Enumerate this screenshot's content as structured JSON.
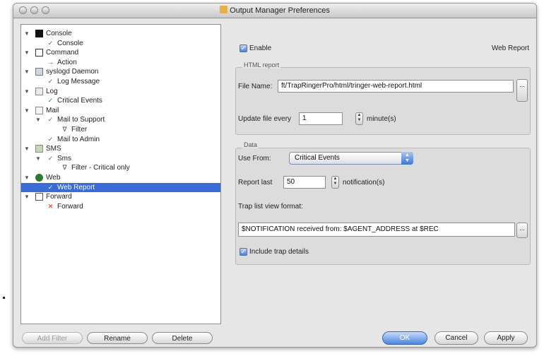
{
  "window": {
    "title": "Output Manager Preferences"
  },
  "tree": {
    "items": [
      {
        "label": "Console",
        "level": 0,
        "icon": "console-icon"
      },
      {
        "label": "Console",
        "level": 1,
        "icon": "check-icon"
      },
      {
        "label": "Command",
        "level": 0,
        "icon": "command-icon"
      },
      {
        "label": "Action",
        "level": 1,
        "icon": "arrow-icon"
      },
      {
        "label": "syslogd Daemon",
        "level": 0,
        "icon": "syslog-icon"
      },
      {
        "label": "Log Message",
        "level": 1,
        "icon": "check-icon"
      },
      {
        "label": "Log",
        "level": 0,
        "icon": "log-icon"
      },
      {
        "label": "Critical Events",
        "level": 1,
        "icon": "check-icon"
      },
      {
        "label": "Mail",
        "level": 0,
        "icon": "mail-icon"
      },
      {
        "label": "Mail to Support",
        "level": 1,
        "icon": "check-icon"
      },
      {
        "label": "Filter",
        "level": 2,
        "icon": "filter-icon"
      },
      {
        "label": "Mail to Admin",
        "level": 1,
        "icon": "check-icon"
      },
      {
        "label": "SMS",
        "level": 0,
        "icon": "sms-icon"
      },
      {
        "label": "Sms",
        "level": 1,
        "icon": "check-icon"
      },
      {
        "label": "Filter - Critical only",
        "level": 2,
        "icon": "filter-icon"
      },
      {
        "label": "Web",
        "level": 0,
        "icon": "web-icon"
      },
      {
        "label": "Web Report",
        "level": 1,
        "icon": "check-icon"
      },
      {
        "label": "Forward",
        "level": 0,
        "icon": "forward-icon"
      },
      {
        "label": "Forward",
        "level": 1,
        "icon": "x-icon"
      }
    ]
  },
  "tree_buttons": {
    "add_filter": "Add Filter",
    "rename": "Rename",
    "delete": "Delete"
  },
  "panel": {
    "enable_label": "Enable",
    "type_label": "Web Report",
    "html_group": "HTML report",
    "file_name_label": "File Name:",
    "file_name_value": "ft/TrapRingerPro/html/tringer-web-report.html",
    "update_label": "Update file every",
    "update_value": "1",
    "update_unit": "minute(s)",
    "data_group": "Data",
    "use_from_label": "Use From:",
    "use_from_value": "Critical Events",
    "report_last_label": "Report last",
    "report_last_value": "50",
    "report_last_unit": "notification(s)",
    "format_label": "Trap list view format:",
    "format_value": "$NOTIFICATION received from: $AGENT_ADDRESS at $REC",
    "include_label": "Include trap details",
    "ellipsis": "..."
  },
  "buttons": {
    "ok": "OK",
    "cancel": "Cancel",
    "apply": "Apply"
  },
  "colors": {
    "selection": "#3a6bd6",
    "accent": "#4a86e0"
  }
}
